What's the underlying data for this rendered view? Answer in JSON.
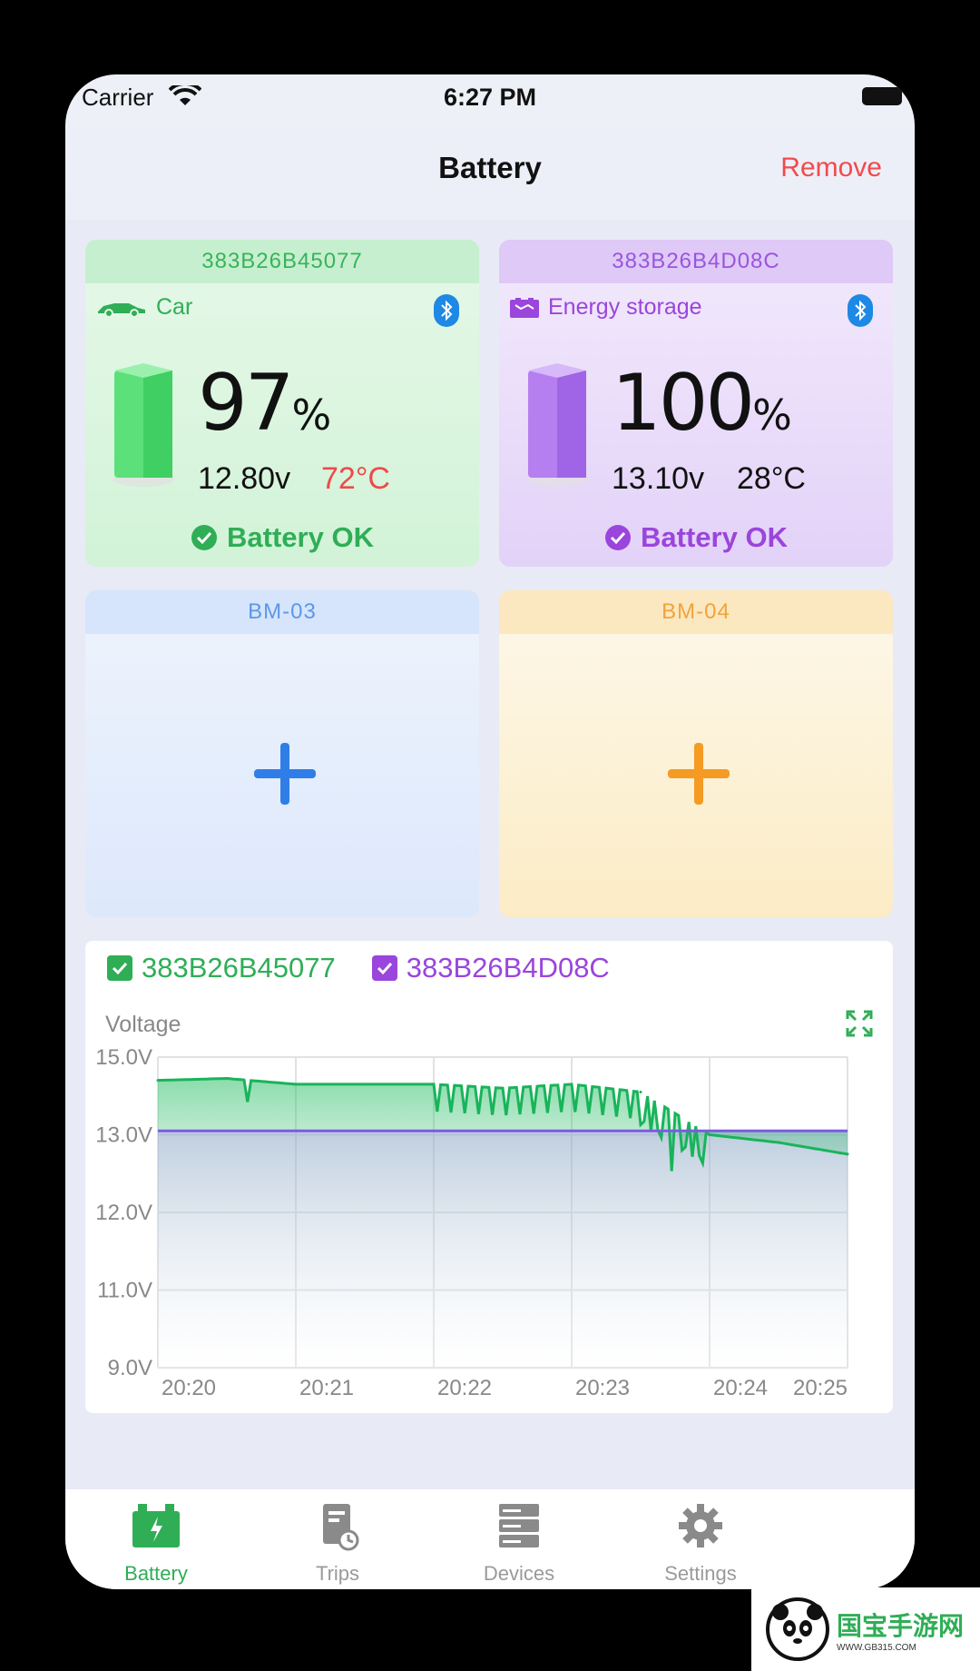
{
  "status_bar": {
    "carrier": "Carrier",
    "time": "6:27 PM"
  },
  "navbar": {
    "title": "Battery",
    "remove_label": "Remove",
    "remove_color": "#f24b4b"
  },
  "batteries": [
    {
      "id": "383B26B45077",
      "type": "Car",
      "type_icon": "car-icon",
      "percent": "97",
      "unit": "%",
      "voltage": "12.80v",
      "temperature": "72°C",
      "status": "Battery OK",
      "accent": "#2fae56",
      "level": 0.97
    },
    {
      "id": "383B26B4D08C",
      "type": "Energy storage",
      "type_icon": "battery-box-icon",
      "percent": "100",
      "unit": "%",
      "voltage": "13.10v",
      "temperature": "28°C",
      "status": "Battery OK",
      "accent": "#9a45dc",
      "level": 1.0
    }
  ],
  "empty_slots": [
    {
      "label": "BM-03",
      "accent": "#2f7ee8",
      "icon": "plus-icon"
    },
    {
      "label": "BM-04",
      "accent": "#f59a23",
      "icon": "plus-icon"
    }
  ],
  "chart_legend": {
    "series_1": "383B26B45077",
    "series_2": "383B26B4D08C",
    "ylabel": "Voltage"
  },
  "chart_data": {
    "type": "area",
    "ylabel": "Voltage",
    "y_tick_labels": [
      "15.0V",
      "13.0V",
      "12.0V",
      "11.0V",
      "9.0V"
    ],
    "x_tick_labels": [
      "20:20",
      "20:21",
      "20:22",
      "20:23",
      "20:24",
      "20:25"
    ],
    "grid": true,
    "legend_placement": "top-left",
    "series": [
      {
        "name": "383B26B45077",
        "color": "#18b45a",
        "x": [
          "20:20",
          "20:20:30",
          "20:21",
          "20:21:30",
          "20:22",
          "20:22:30",
          "20:23",
          "20:23:30",
          "20:24",
          "20:24:30",
          "20:25"
        ],
        "values": [
          14.4,
          14.45,
          14.3,
          14.3,
          14.3,
          14.2,
          14.3,
          14.1,
          13.0,
          12.9,
          12.75
        ]
      },
      {
        "name": "383B26B4D08C",
        "color": "#7b5be0",
        "x": [
          "20:20",
          "20:25"
        ],
        "values": [
          13.1,
          13.1
        ]
      }
    ]
  },
  "tabs": [
    {
      "label": "Battery",
      "icon": "battery-tab-icon",
      "active": true
    },
    {
      "label": "Trips",
      "icon": "trips-tab-icon",
      "active": false
    },
    {
      "label": "Devices",
      "icon": "devices-tab-icon",
      "active": false
    },
    {
      "label": "Settings",
      "icon": "gear-icon",
      "active": false
    }
  ],
  "watermark": {
    "text": "国宝手游网",
    "url": "WWW.GB315.COM"
  }
}
